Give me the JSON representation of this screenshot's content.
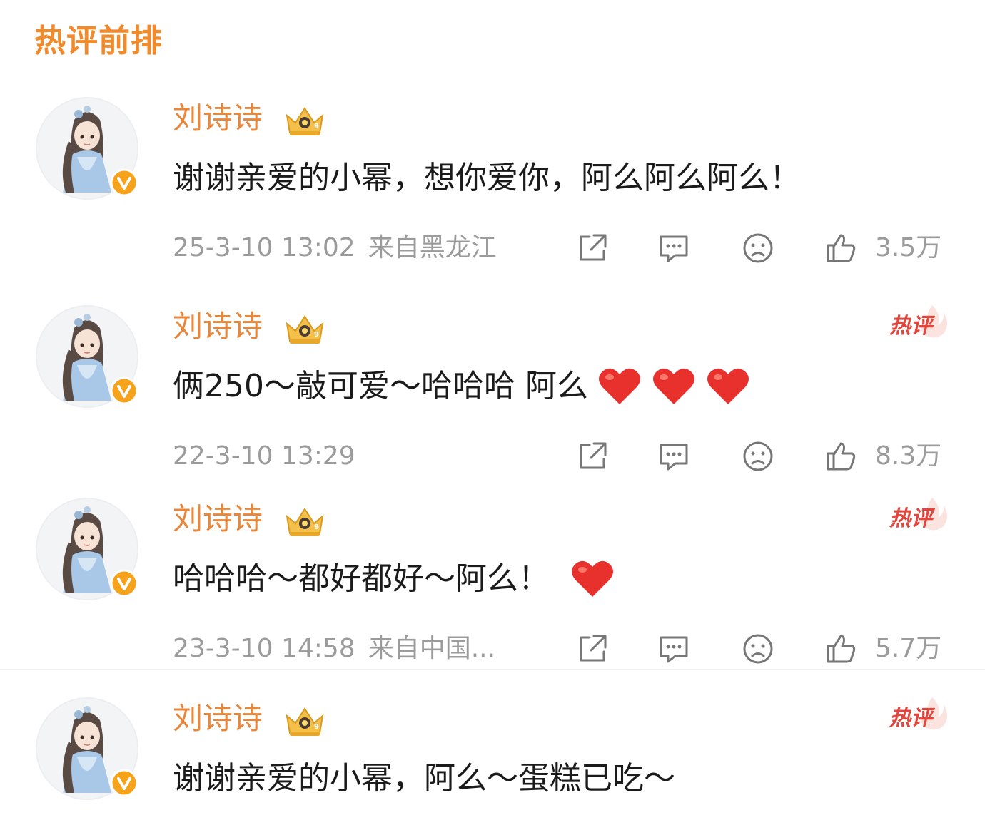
{
  "section_title": "热评前排",
  "colors": {
    "accent": "#f08a2a",
    "username": "#e8863a",
    "hot_tag": "#e2453c",
    "meta_text": "#9b9b9b",
    "heart": "#e8302c"
  },
  "comments": [
    {
      "username": "刘诗诗",
      "text": "谢谢亲爱的小幂，想你爱你，阿么阿么阿么！",
      "emoji_count": 0,
      "hot": false,
      "time": "25-3-10 13:02",
      "location": "来自黑龙江",
      "likes": "3.5万"
    },
    {
      "username": "刘诗诗",
      "text": "俩250～敲可爱～哈哈哈 阿么",
      "emoji_count": 3,
      "hot": true,
      "hot_label": "热评",
      "time": "22-3-10 13:29",
      "location": "",
      "likes": "8.3万"
    },
    {
      "username": "刘诗诗",
      "text": "哈哈哈～都好都好～阿么！",
      "emoji_count": 1,
      "hot": true,
      "hot_label": "热评",
      "time": "23-3-10 14:58",
      "location": "来自中国...",
      "likes": "5.7万"
    },
    {
      "username": "刘诗诗",
      "text": "谢谢亲爱的小幂，阿么～蛋糕已吃～",
      "emoji_count": 0,
      "hot": true,
      "hot_label": "热评"
    }
  ],
  "icons": {
    "share": "share-icon",
    "comment": "comment-bubble-icon",
    "dislike": "sad-face-icon",
    "like": "thumbs-up-icon",
    "verified": "verified-v-icon",
    "crown": "vip-crown-icon",
    "emoji": "red-heart-emoji"
  }
}
